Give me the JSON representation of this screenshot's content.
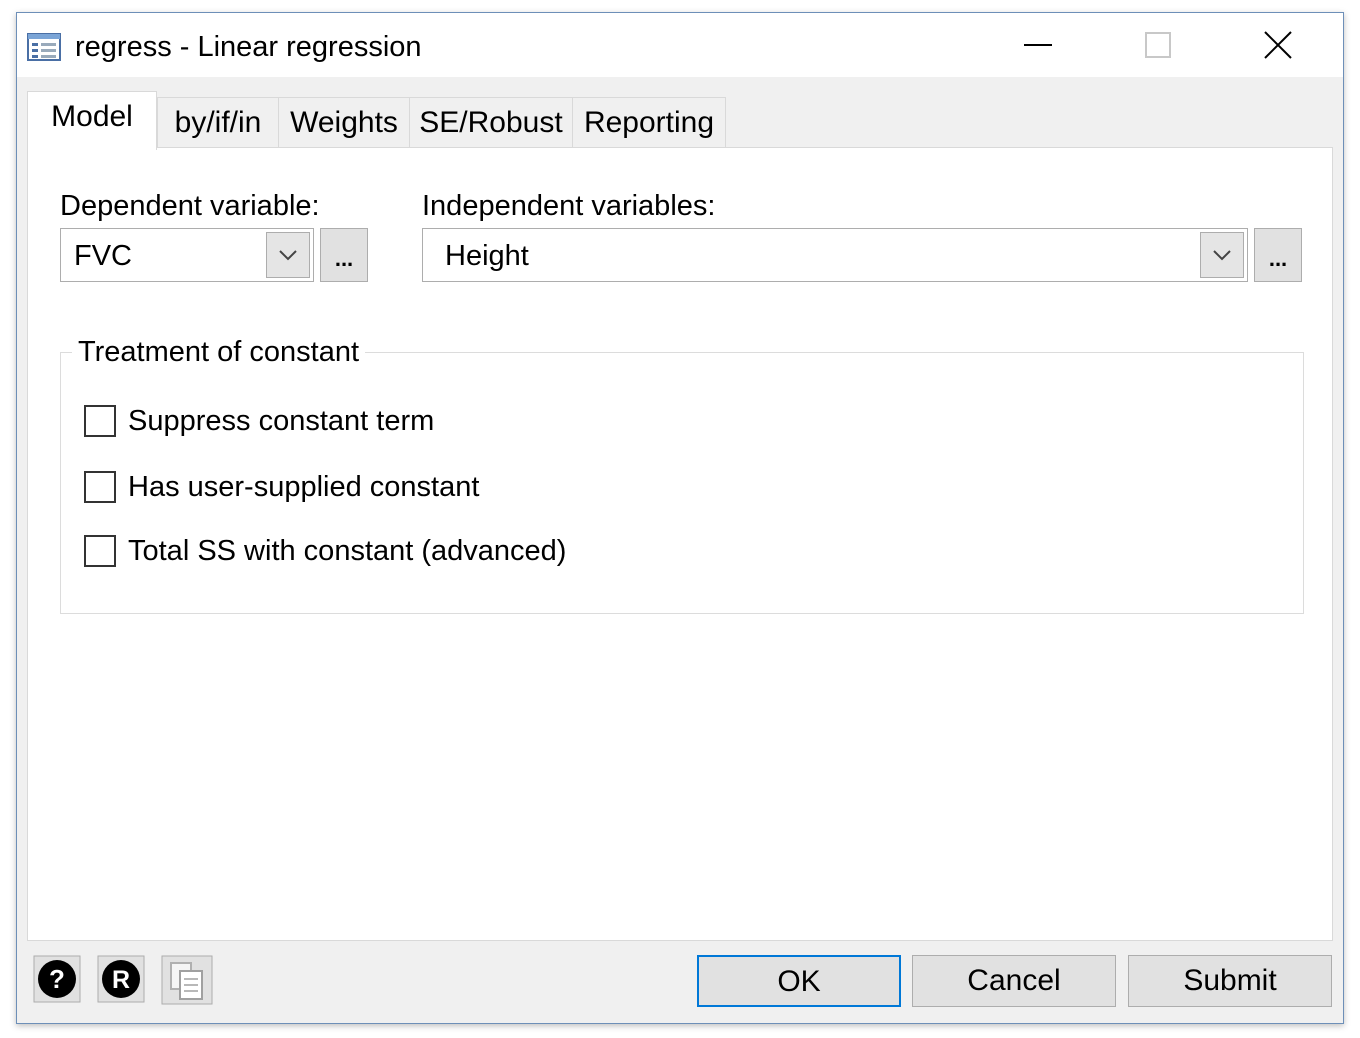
{
  "window": {
    "title": "regress - Linear regression",
    "accent_color": "#0078d7",
    "icons": [
      "dialog-icon",
      "minimize-icon",
      "maximize-icon",
      "close-icon"
    ]
  },
  "tabs": [
    {
      "label": "Model",
      "active": true
    },
    {
      "label": "by/if/in",
      "active": false
    },
    {
      "label": "Weights",
      "active": false
    },
    {
      "label": "SE/Robust",
      "active": false
    },
    {
      "label": "Reporting",
      "active": false
    }
  ],
  "model": {
    "dependent_label": "Dependent variable:",
    "dependent_value": "FVC",
    "independent_label": "Independent variables:",
    "independent_value": "Height",
    "browse_label": "...",
    "group_title": "Treatment of constant",
    "options": [
      {
        "label": "Suppress constant term",
        "checked": false
      },
      {
        "label": "Has user-supplied constant",
        "checked": false
      },
      {
        "label": "Total SS with constant (advanced)",
        "checked": false
      }
    ]
  },
  "footer": {
    "icons": [
      "help-icon",
      "reset-icon",
      "copy-command-icon"
    ],
    "ok_label": "OK",
    "cancel_label": "Cancel",
    "submit_label": "Submit"
  }
}
